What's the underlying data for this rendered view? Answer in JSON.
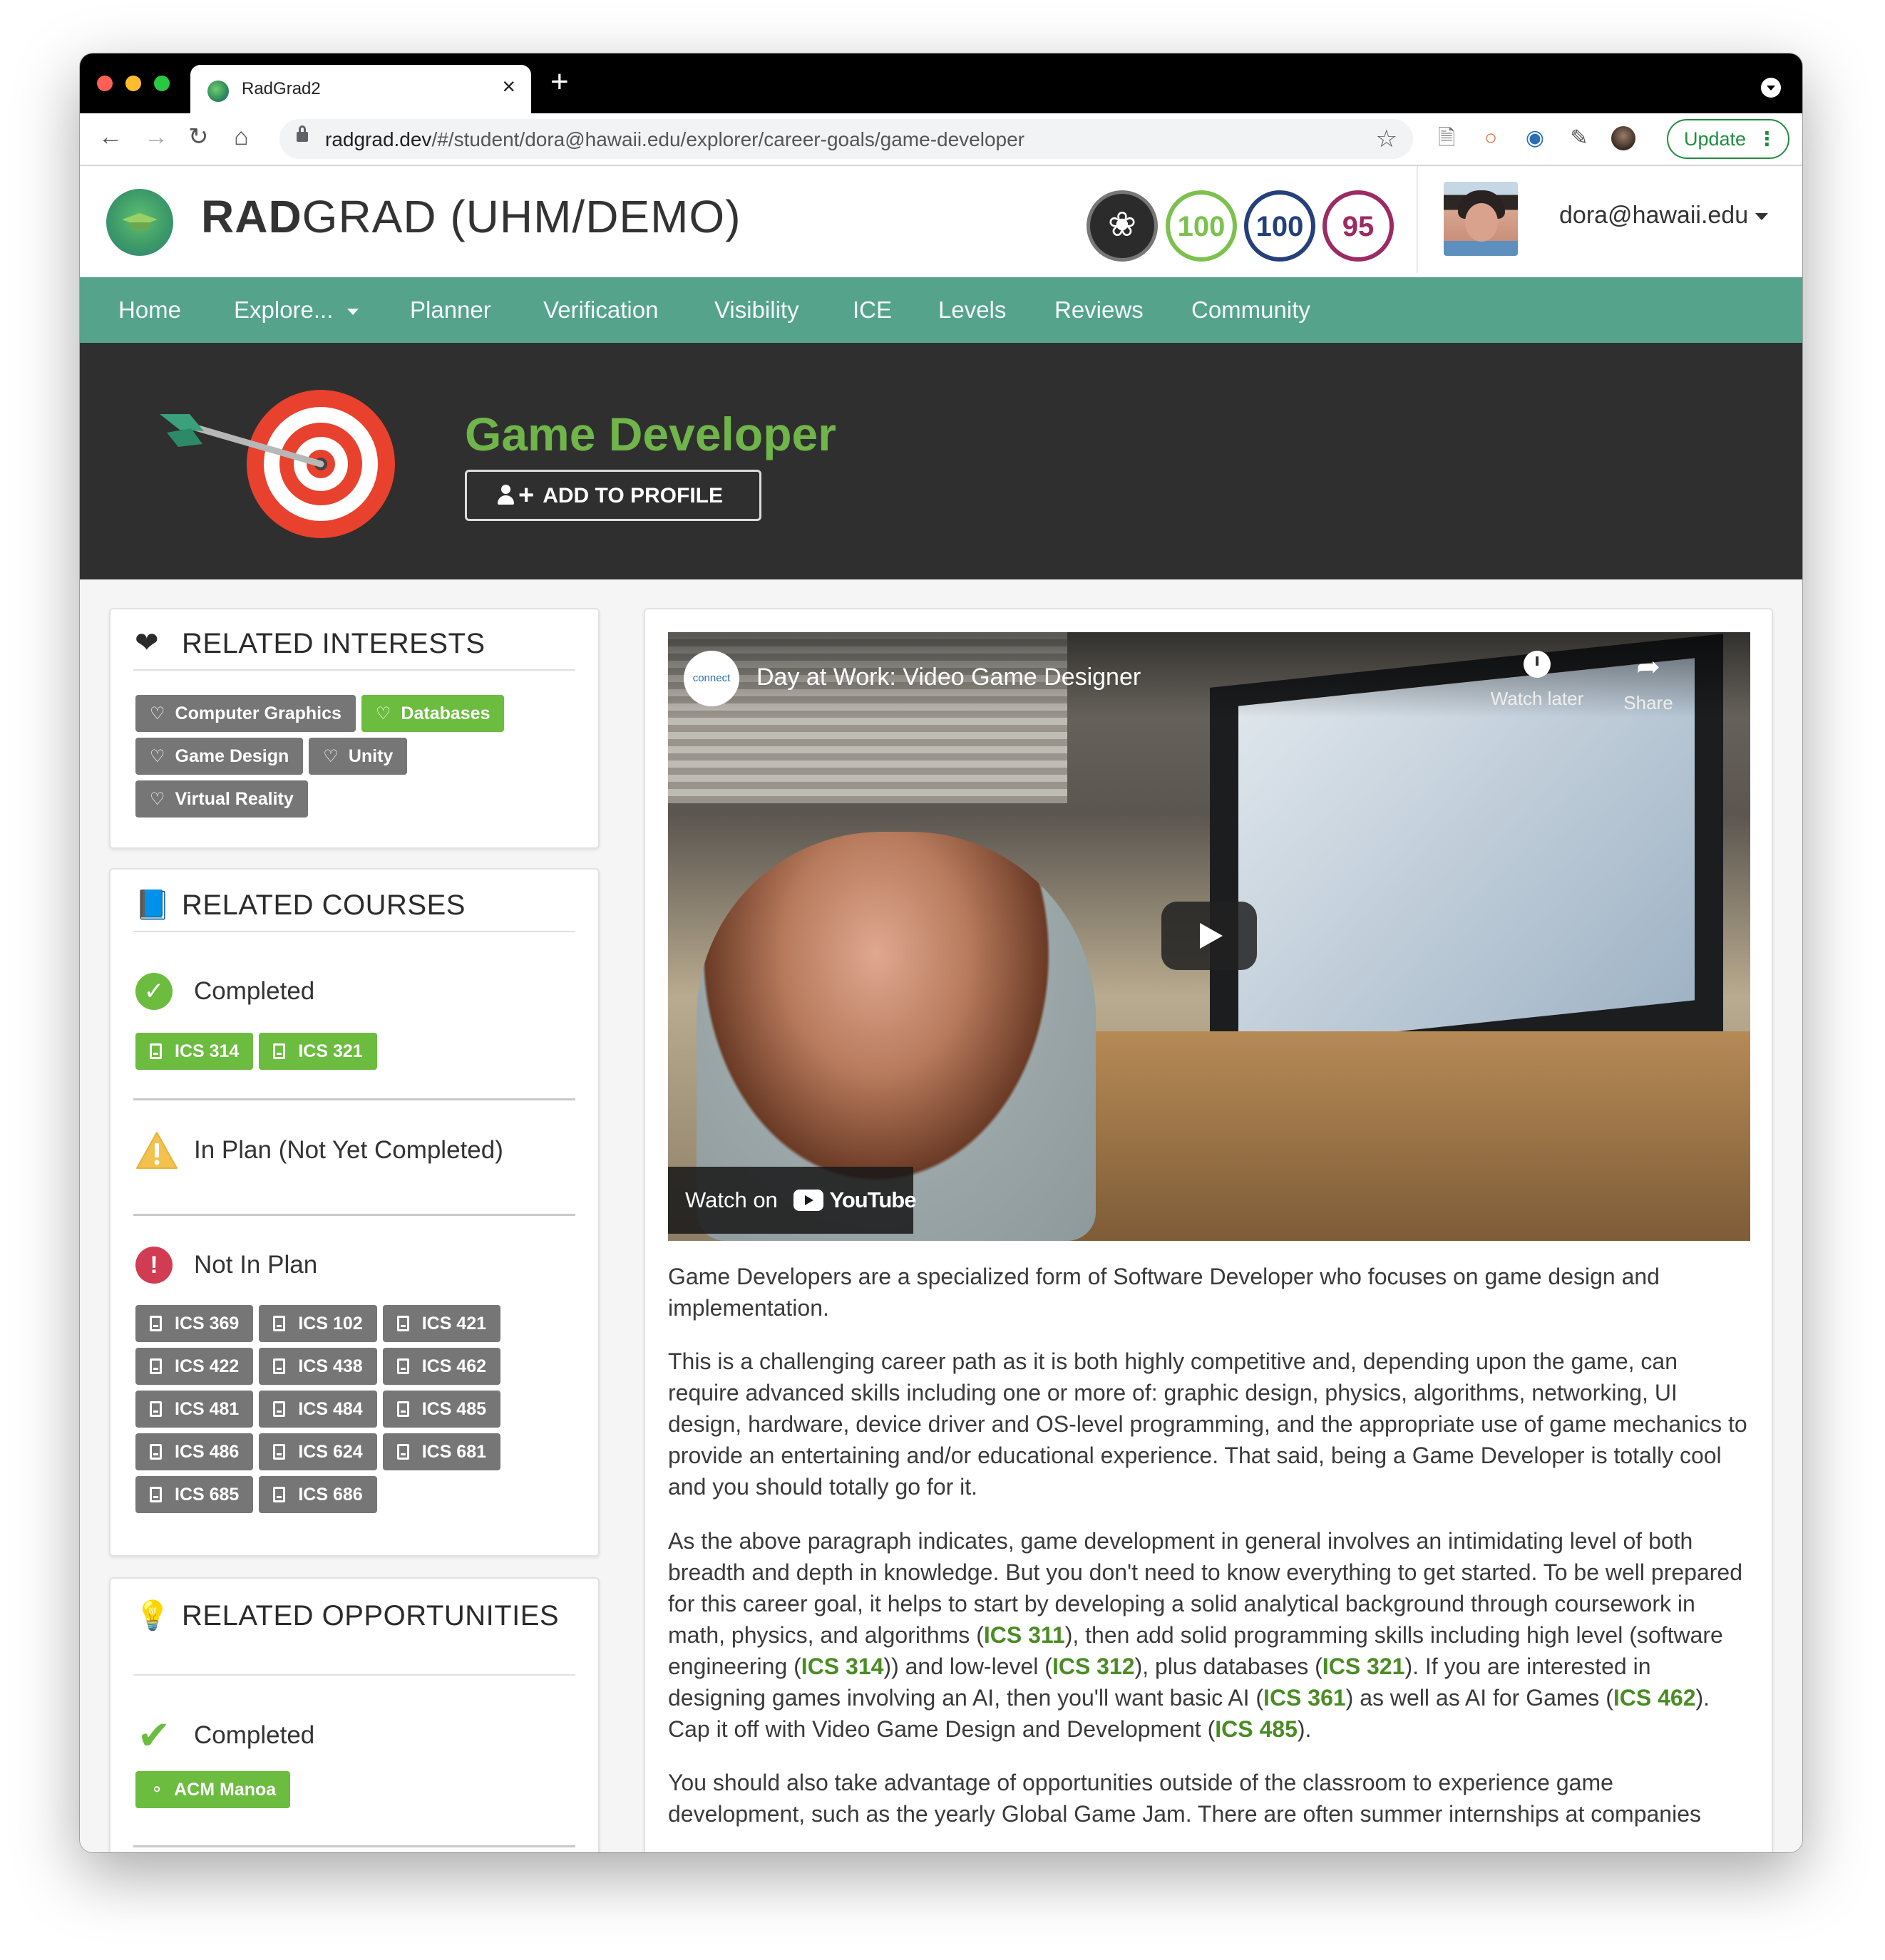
{
  "browser": {
    "tab_title": "RadGrad2",
    "close_glyph": "×",
    "new_tab_glyph": "+",
    "url_domain": "radgrad.dev",
    "url_path": "/#/student/dora@hawaii.edu/explorer/career-goals/game-developer",
    "update_label": "Update",
    "traffic_colors": [
      "#ff5f57",
      "#febc2e",
      "#28c840"
    ]
  },
  "header": {
    "brand_bold": "RAD",
    "brand_rest": "GRAD (UHM/DEMO)",
    "ice_scores": [
      {
        "value": "100",
        "color": "#7cc14e",
        "icon": "innovation"
      },
      {
        "value": "100",
        "color": "#24407a",
        "icon": "competency"
      },
      {
        "value": "95",
        "color": "#9c2a63",
        "icon": "experience"
      }
    ],
    "user_email": "dora@hawaii.edu"
  },
  "nav": {
    "items": [
      "Home",
      "Explore...",
      "Planner",
      "Verification",
      "Visibility",
      "ICE",
      "Levels",
      "Reviews",
      "Community"
    ]
  },
  "hero": {
    "title": "Game Developer",
    "add_button": "ADD TO PROFILE",
    "icon": "target-icon"
  },
  "related_interests": {
    "title": "RELATED INTERESTS",
    "items": [
      {
        "label": "Computer Graphics",
        "highlighted": false
      },
      {
        "label": "Databases",
        "highlighted": true
      },
      {
        "label": "Game Design",
        "highlighted": false
      },
      {
        "label": "Unity",
        "highlighted": false
      },
      {
        "label": "Virtual Reality",
        "highlighted": false
      }
    ]
  },
  "related_courses": {
    "title": "RELATED COURSES",
    "completed_label": "Completed",
    "completed": [
      "ICS 314",
      "ICS 321"
    ],
    "in_plan_label": "In Plan (Not Yet Completed)",
    "in_plan": [],
    "not_in_plan_label": "Not In Plan",
    "not_in_plan": [
      "ICS 369",
      "ICS 102",
      "ICS 421",
      "ICS 422",
      "ICS 438",
      "ICS 462",
      "ICS 481",
      "ICS 484",
      "ICS 485",
      "ICS 486",
      "ICS 624",
      "ICS 681",
      "ICS 685",
      "ICS 686"
    ]
  },
  "related_opportunities": {
    "title": "RELATED OPPORTUNITIES",
    "completed_label": "Completed",
    "completed": [
      "ACM Manoa"
    ]
  },
  "video": {
    "channel": "connect",
    "title": "Day at Work: Video Game Designer",
    "watch_later": "Watch later",
    "share": "Share",
    "watch_on": "Watch on",
    "youtube": "YouTube"
  },
  "description": {
    "p1": "Game Developers are a specialized form of Software Developer who focuses on game design and implementation.",
    "p2": "This is a challenging career path as it is both highly competitive and, depending upon the game, can require advanced skills including one or more of: graphic design, physics, algorithms, networking, UI design, hardware, device driver and OS-level programming, and the appropriate use of game mechanics to provide an entertaining and/or educational experience. That said, being a Game Developer is totally cool and you should totally go for it.",
    "p3_parts": [
      {
        "t": "As the above paragraph indicates, game development in general involves an intimidating level of both breadth and depth in knowledge. But you don't need to know everything to get started. To be well prepared for this career goal, it helps to start by developing a solid analytical background through coursework in math, physics, and algorithms ("
      },
      {
        "c": "ICS 311"
      },
      {
        "t": "), then add solid programming skills including high level (software engineering ("
      },
      {
        "c": "ICS 314"
      },
      {
        "t": ")) and low-level ("
      },
      {
        "c": "ICS 312"
      },
      {
        "t": "), plus databases ("
      },
      {
        "c": "ICS 321"
      },
      {
        "t": "). If you are interested in designing games involving an AI, then you'll want basic AI ("
      },
      {
        "c": "ICS 361"
      },
      {
        "t": ") as well as AI for Games ("
      },
      {
        "c": "ICS 462"
      },
      {
        "t": "). Cap it off with Video Game Design and Development ("
      },
      {
        "c": "ICS 485"
      },
      {
        "t": ")."
      }
    ],
    "p4": "You should also take advantage of opportunities outside of the classroom to experience game development, such as the yearly Global Game Jam. There are often summer internships at companies"
  },
  "colors": {
    "nav_green": "#55a38b",
    "hero_bg": "#2f2f2f",
    "title_green": "#6fb54a",
    "chip_gray": "#767676",
    "chip_green": "#6bbc3f",
    "course_link": "#4a8c24"
  }
}
